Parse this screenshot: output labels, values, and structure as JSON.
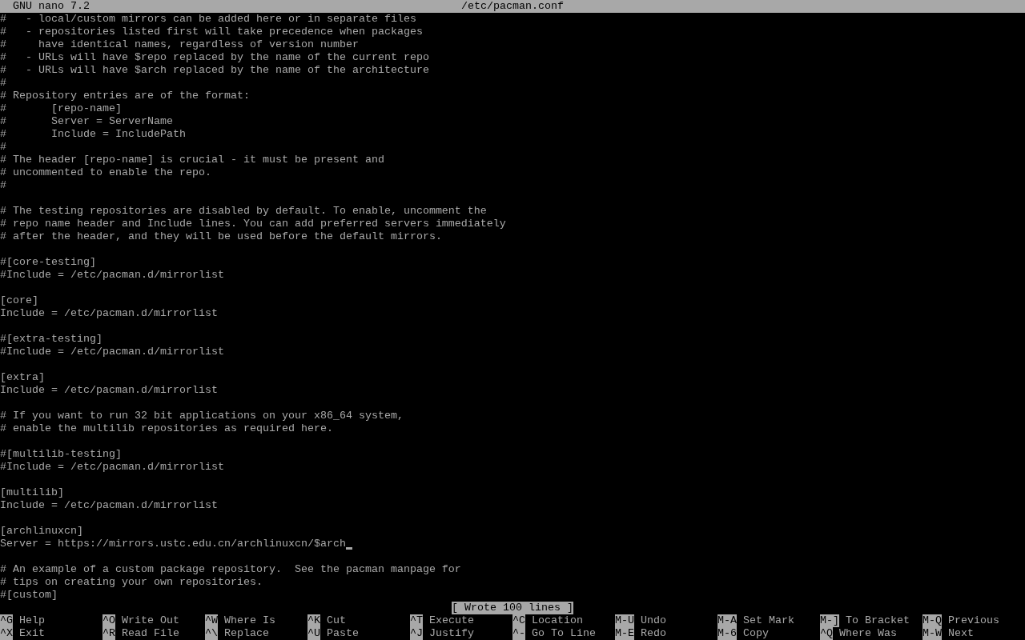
{
  "title_bar": {
    "app": "GNU nano 7.2",
    "file": "/etc/pacman.conf"
  },
  "lines": [
    {
      "kind": "text",
      "text": "#   - local/custom mirrors can be added here or in separate files",
      "cursor": false
    },
    {
      "kind": "text",
      "text": "#   - repositories listed first will take precedence when packages",
      "cursor": false
    },
    {
      "kind": "text",
      "text": "#     have identical names, regardless of version number",
      "cursor": false
    },
    {
      "kind": "text",
      "text": "#   - URLs will have $repo replaced by the name of the current repo",
      "cursor": false
    },
    {
      "kind": "text",
      "text": "#   - URLs will have $arch replaced by the name of the architecture",
      "cursor": false
    },
    {
      "kind": "text",
      "text": "#",
      "cursor": false
    },
    {
      "kind": "text",
      "text": "# Repository entries are of the format:",
      "cursor": false
    },
    {
      "kind": "text",
      "text": "#       [repo-name]",
      "cursor": false
    },
    {
      "kind": "text",
      "text": "#       Server = ServerName",
      "cursor": false
    },
    {
      "kind": "text",
      "text": "#       Include = IncludePath",
      "cursor": false
    },
    {
      "kind": "text",
      "text": "#",
      "cursor": false
    },
    {
      "kind": "text",
      "text": "# The header [repo-name] is crucial - it must be present and",
      "cursor": false
    },
    {
      "kind": "text",
      "text": "# uncommented to enable the repo.",
      "cursor": false
    },
    {
      "kind": "text",
      "text": "#",
      "cursor": false
    },
    {
      "kind": "blank"
    },
    {
      "kind": "text",
      "text": "# The testing repositories are disabled by default. To enable, uncomment the",
      "cursor": false
    },
    {
      "kind": "text",
      "text": "# repo name header and Include lines. You can add preferred servers immediately",
      "cursor": false
    },
    {
      "kind": "text",
      "text": "# after the header, and they will be used before the default mirrors.",
      "cursor": false
    },
    {
      "kind": "blank"
    },
    {
      "kind": "text",
      "text": "#[core-testing]",
      "cursor": false
    },
    {
      "kind": "text",
      "text": "#Include = /etc/pacman.d/mirrorlist",
      "cursor": false
    },
    {
      "kind": "blank"
    },
    {
      "kind": "text",
      "text": "[core]",
      "cursor": false
    },
    {
      "kind": "text",
      "text": "Include = /etc/pacman.d/mirrorlist",
      "cursor": false
    },
    {
      "kind": "blank"
    },
    {
      "kind": "text",
      "text": "#[extra-testing]",
      "cursor": false
    },
    {
      "kind": "text",
      "text": "#Include = /etc/pacman.d/mirrorlist",
      "cursor": false
    },
    {
      "kind": "blank"
    },
    {
      "kind": "text",
      "text": "[extra]",
      "cursor": false
    },
    {
      "kind": "text",
      "text": "Include = /etc/pacman.d/mirrorlist",
      "cursor": false
    },
    {
      "kind": "blank"
    },
    {
      "kind": "text",
      "text": "# If you want to run 32 bit applications on your x86_64 system,",
      "cursor": false
    },
    {
      "kind": "text",
      "text": "# enable the multilib repositories as required here.",
      "cursor": false
    },
    {
      "kind": "blank"
    },
    {
      "kind": "text",
      "text": "#[multilib-testing]",
      "cursor": false
    },
    {
      "kind": "text",
      "text": "#Include = /etc/pacman.d/mirrorlist",
      "cursor": false
    },
    {
      "kind": "blank"
    },
    {
      "kind": "text",
      "text": "[multilib]",
      "cursor": false
    },
    {
      "kind": "text",
      "text": "Include = /etc/pacman.d/mirrorlist",
      "cursor": false
    },
    {
      "kind": "blank"
    },
    {
      "kind": "text",
      "text": "[archlinuxcn]",
      "cursor": false
    },
    {
      "kind": "text",
      "text": "Server = https://mirrors.ustc.edu.cn/archlinuxcn/$arch",
      "cursor": true
    },
    {
      "kind": "blank"
    },
    {
      "kind": "text",
      "text": "# An example of a custom package repository.  See the pacman manpage for",
      "cursor": false
    },
    {
      "kind": "text",
      "text": "# tips on creating your own repositories.",
      "cursor": false
    },
    {
      "kind": "text",
      "text": "#[custom]",
      "cursor": false
    }
  ],
  "status": "[ Wrote 100 lines ]",
  "shortcuts": [
    {
      "key": "^G",
      "label": "Help"
    },
    {
      "key": "^O",
      "label": "Write Out"
    },
    {
      "key": "^W",
      "label": "Where Is"
    },
    {
      "key": "^K",
      "label": "Cut"
    },
    {
      "key": "^T",
      "label": "Execute"
    },
    {
      "key": "^C",
      "label": "Location"
    },
    {
      "key": "M-U",
      "label": "Undo"
    },
    {
      "key": "M-A",
      "label": "Set Mark"
    },
    {
      "key": "M-]",
      "label": "To Bracket"
    },
    {
      "key": "M-Q",
      "label": "Previous"
    },
    {
      "key": "^X",
      "label": "Exit"
    },
    {
      "key": "^R",
      "label": "Read File"
    },
    {
      "key": "^\\",
      "label": "Replace"
    },
    {
      "key": "^U",
      "label": "Paste"
    },
    {
      "key": "^J",
      "label": "Justify"
    },
    {
      "key": "^-",
      "label": "Go To Line"
    },
    {
      "key": "M-E",
      "label": "Redo"
    },
    {
      "key": "M-6",
      "label": "Copy"
    },
    {
      "key": "^Q",
      "label": "Where Was"
    },
    {
      "key": "M-W",
      "label": "Next"
    }
  ]
}
